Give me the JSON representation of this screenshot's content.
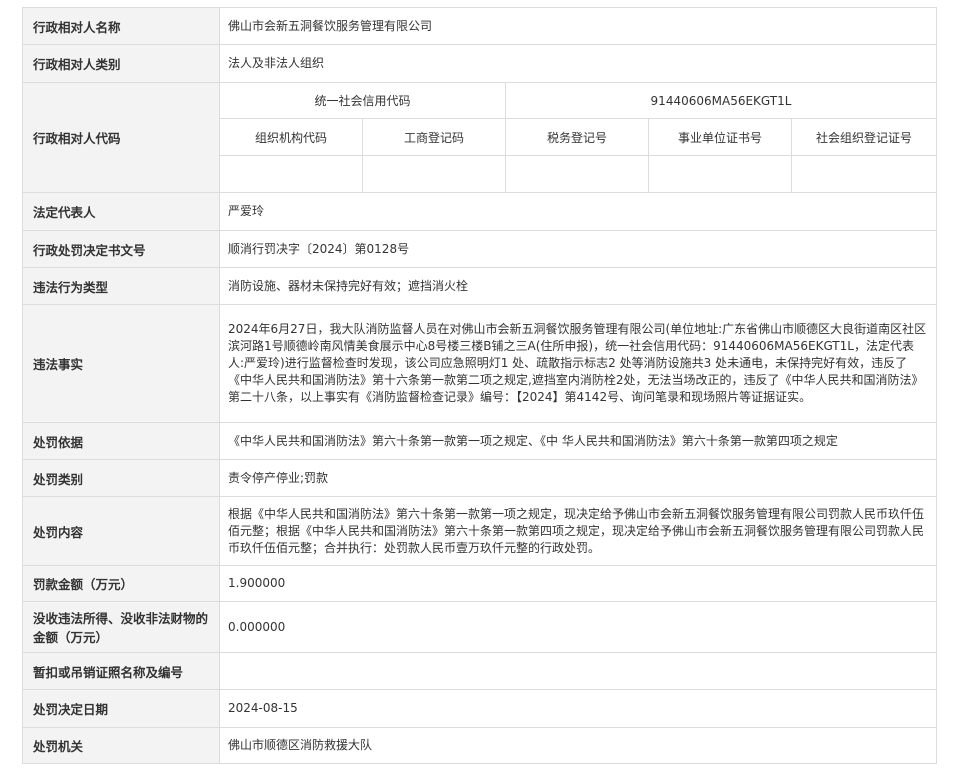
{
  "rows": {
    "entity_name": {
      "label": "行政相对人名称",
      "value": "佛山市会新五洞餐饮服务管理有限公司"
    },
    "entity_type": {
      "label": "行政相对人类别",
      "value": "法人及非法人组织"
    },
    "entity_code": {
      "label": "行政相对人代码",
      "credit_code_label": "统一社会信用代码",
      "credit_code_value": "91440606MA56EKGT1L",
      "sub_headers": [
        "组织机构代码",
        "工商登记码",
        "税务登记号",
        "事业单位证书号",
        "社会组织登记证号"
      ]
    },
    "legal_rep": {
      "label": "法定代表人",
      "value": "严爱玲"
    },
    "decision_no": {
      "label": "行政处罚决定书文号",
      "value": "顺消行罚决字〔2024〕第0128号"
    },
    "violation_type": {
      "label": "违法行为类型",
      "value": "消防设施、器材未保持完好有效；遮挡消火栓"
    },
    "facts": {
      "label": "违法事实",
      "value": "2024年6月27日，我大队消防监督人员在对佛山市会新五洞餐饮服务管理有限公司(单位地址:广东省佛山市顺德区大良街道南区社区滨河路1号顺德岭南风情美食展示中心8号楼三楼B铺之三A(住所申报)，统一社会信用代码：91440606MA56EKGT1L，法定代表人:严爱玲)进行监督检查时发现，该公司应急照明灯1 处、疏散指示标志2 处等消防设施共3 处未通电，未保持完好有效，违反了《中华人民共和国消防法》第十六条第一款第二项之规定,遮挡室内消防栓2处，无法当场改正的，违反了《中华人民共和国消防法》第二十八条，以上事实有《消防监督检查记录》编号：【2024】第4142号、询问笔录和现场照片等证据证实。"
    },
    "basis": {
      "label": "处罚依据",
      "value": "《中华人民共和国消防法》第六十条第一款第一项之规定、《中 华人民共和国消防法》第六十条第一款第四项之规定"
    },
    "category": {
      "label": "处罚类别",
      "value": "责令停产停业;罚款"
    },
    "content": {
      "label": "处罚内容",
      "value": "根据《中华人民共和国消防法》第六十条第一款第一项之规定，现决定给予佛山市会新五洞餐饮服务管理有限公司罚款人民币玖仟伍佰元整；根据《中华人民共和国消防法》第六十条第一款第四项之规定，现决定给予佛山市会新五洞餐饮服务管理有限公司罚款人民币玖仟伍佰元整；合并执行：处罚款人民币壹万玖仟元整的行政处罚。"
    },
    "fine": {
      "label": "罚款金额（万元）",
      "value": "1.900000"
    },
    "confiscation": {
      "label": "没收违法所得、没收非法财物的金额（万元）",
      "value": "0.000000"
    },
    "license": {
      "label": "暂扣或吊销证照名称及编号",
      "value": ""
    },
    "decision_date": {
      "label": "处罚决定日期",
      "value": "2024-08-15"
    },
    "authority": {
      "label": "处罚机关",
      "value": "佛山市顺德区消防救援大队"
    }
  }
}
